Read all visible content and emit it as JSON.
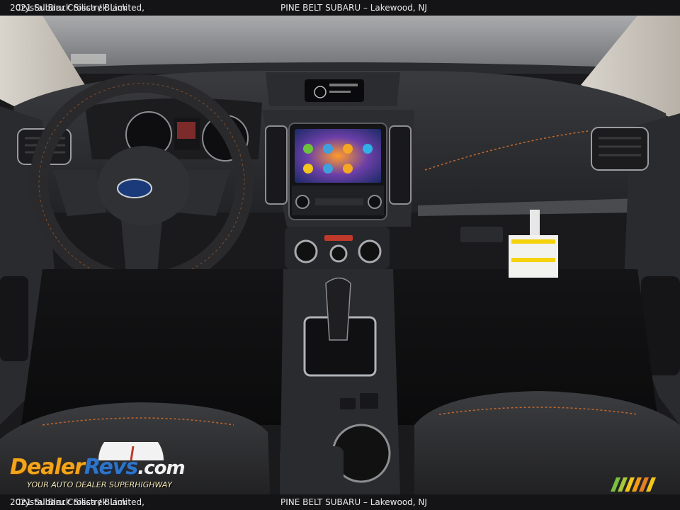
{
  "caption": {
    "vehicle": "2021 Subaru Crosstrek Limited,",
    "color": "Crystal Black Silica / Black",
    "dealer": "PINE BELT SUBARU – Lakewood, NJ"
  },
  "watermark": {
    "brand_part1": "Dealer",
    "brand_part2": "Revs",
    "brand_part3": ".com",
    "tagline": "YOUR AUTO DEALER SUPERHIGHWAY"
  },
  "colors": {
    "cabin_black": "#1a1a1c",
    "stitching_orange": "#c4682c",
    "windshield_gray": "#8d8f92",
    "watermark_orange": "#f3a51a",
    "watermark_blue": "#2f74c9"
  },
  "screen_icons": [
    "app-icon-1",
    "app-icon-2",
    "app-icon-3",
    "app-icon-4",
    "app-icon-5",
    "app-icon-6",
    "app-icon-7"
  ]
}
